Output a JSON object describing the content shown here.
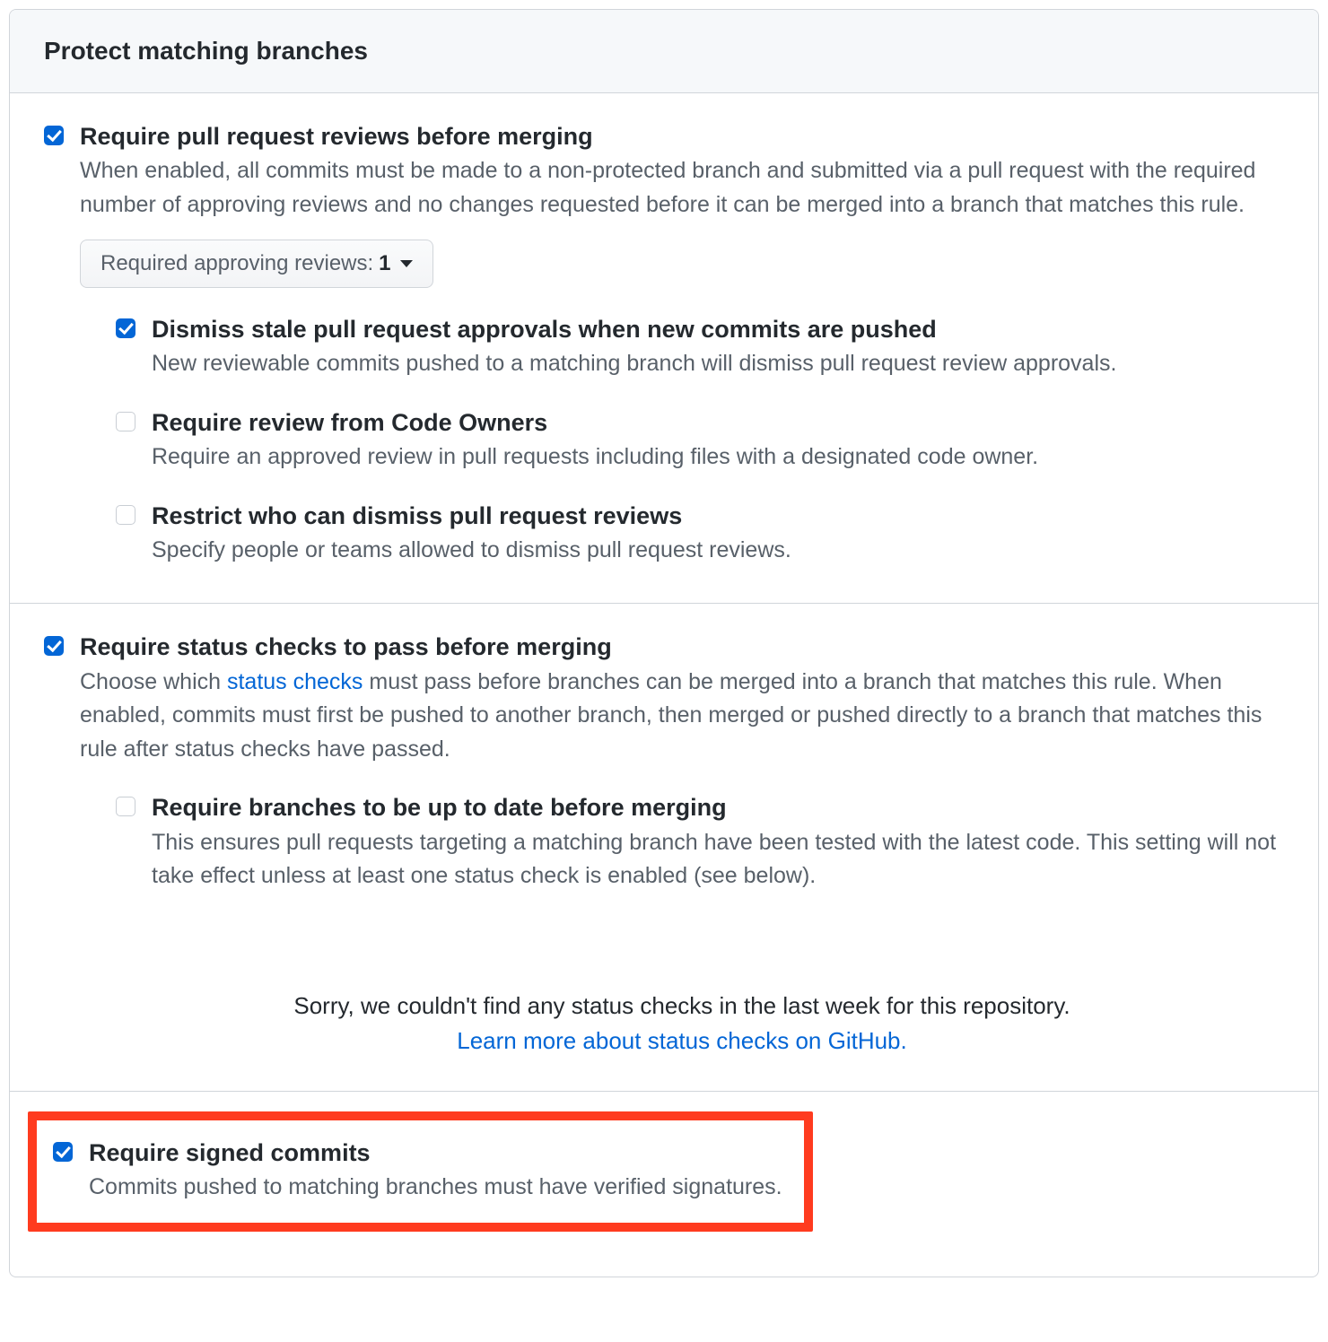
{
  "header": {
    "title": "Protect matching branches"
  },
  "options": {
    "require_pr": {
      "checked": true,
      "title": "Require pull request reviews before merging",
      "desc": "When enabled, all commits must be made to a non-protected branch and submitted via a pull request with the required number of approving reviews and no changes requested before it can be merged into a branch that matches this rule.",
      "dropdown": {
        "label": "Required approving reviews: ",
        "value": "1"
      },
      "sub": {
        "dismiss_stale": {
          "checked": true,
          "title": "Dismiss stale pull request approvals when new commits are pushed",
          "desc": "New reviewable commits pushed to a matching branch will dismiss pull request review approvals."
        },
        "code_owners": {
          "checked": false,
          "title": "Require review from Code Owners",
          "desc": "Require an approved review in pull requests including files with a designated code owner."
        },
        "restrict_dismiss": {
          "checked": false,
          "title": "Restrict who can dismiss pull request reviews",
          "desc": "Specify people or teams allowed to dismiss pull request reviews."
        }
      }
    },
    "require_status": {
      "checked": true,
      "title": "Require status checks to pass before merging",
      "desc_pre": "Choose which ",
      "desc_link": "status checks",
      "desc_post": " must pass before branches can be merged into a branch that matches this rule. When enabled, commits must first be pushed to another branch, then merged or pushed directly to a branch that matches this rule after status checks have passed.",
      "sub": {
        "up_to_date": {
          "checked": false,
          "title": "Require branches to be up to date before merging",
          "desc": "This ensures pull requests targeting a matching branch have been tested with the latest code. This setting will not take effect unless at least one status check is enabled (see below)."
        }
      },
      "empty_state": {
        "text": "Sorry, we couldn't find any status checks in the last week for this repository.",
        "link": "Learn more about status checks on GitHub."
      }
    },
    "require_signed": {
      "checked": true,
      "title": "Require signed commits",
      "desc": "Commits pushed to matching branches must have verified signatures."
    }
  }
}
